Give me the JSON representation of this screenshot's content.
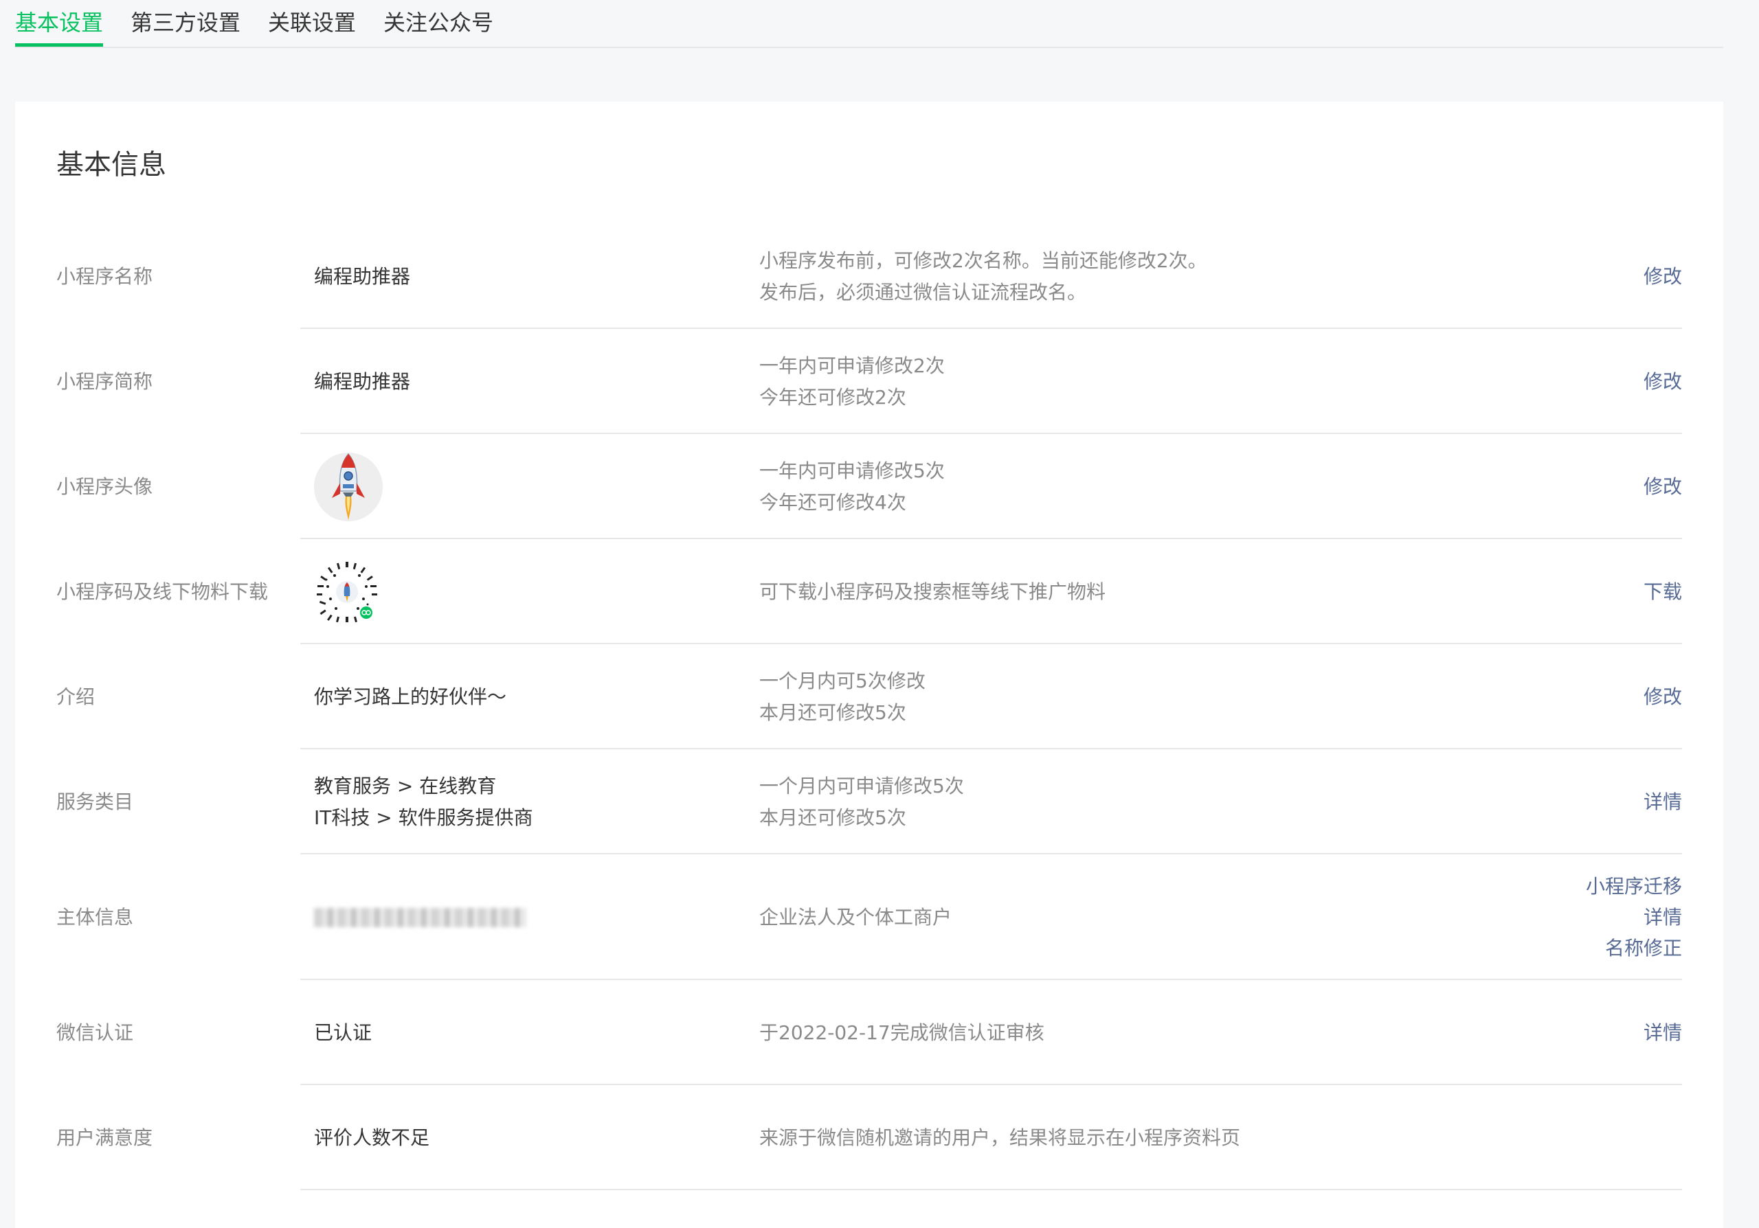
{
  "tabs": [
    {
      "label": "基本设置",
      "active": true
    },
    {
      "label": "第三方设置",
      "active": false
    },
    {
      "label": "关联设置",
      "active": false
    },
    {
      "label": "关注公众号",
      "active": false
    }
  ],
  "card": {
    "title": "基本信息"
  },
  "rows": [
    {
      "label": "小程序名称",
      "value": "编程助推器",
      "desc": [
        "小程序发布前，可修改2次名称。当前还能修改2次。",
        "发布后，必须通过微信认证流程改名。"
      ],
      "actions": [
        "修改"
      ]
    },
    {
      "label": "小程序简称",
      "value": "编程助推器",
      "desc": [
        "一年内可申请修改2次",
        "今年还可修改2次"
      ],
      "actions": [
        "修改"
      ]
    },
    {
      "label": "小程序头像",
      "value_icon": "rocket-icon",
      "desc": [
        "一年内可申请修改5次",
        "今年还可修改4次"
      ],
      "actions": [
        "修改"
      ]
    },
    {
      "label": "小程序码及线下物料下载",
      "value_icon": "mini-program-code-icon",
      "desc": [
        "可下载小程序码及搜索框等线下推广物料"
      ],
      "actions": [
        "下载"
      ]
    },
    {
      "label": "介绍",
      "value": "你学习路上的好伙伴～",
      "desc": [
        "一个月内可5次修改",
        "本月还可修改5次"
      ],
      "actions": [
        "修改"
      ]
    },
    {
      "label": "服务类目",
      "value_lines": [
        "教育服务 > 在线教育",
        "IT科技 > 软件服务提供商"
      ],
      "desc": [
        "一个月内可申请修改5次",
        "本月还可修改5次"
      ],
      "actions": [
        "详情"
      ]
    },
    {
      "label": "主体信息",
      "value_icon": "blurred-entity-name",
      "desc": [
        "企业法人及个体工商户"
      ],
      "actions": [
        "小程序迁移",
        "详情",
        "名称修正"
      ]
    },
    {
      "label": "微信认证",
      "value": "已认证",
      "desc": [
        "于2022-02-17完成微信认证审核"
      ],
      "actions": [
        "详情"
      ]
    },
    {
      "label": "用户满意度",
      "value": "评价人数不足",
      "desc": [
        "来源于微信随机邀请的用户，结果将显示在小程序资料页"
      ],
      "actions": []
    }
  ],
  "colors": {
    "accent_green": "#07c160",
    "link_blue": "#576b95",
    "label_gray": "#8a8a8a",
    "text_dark": "#353535"
  }
}
